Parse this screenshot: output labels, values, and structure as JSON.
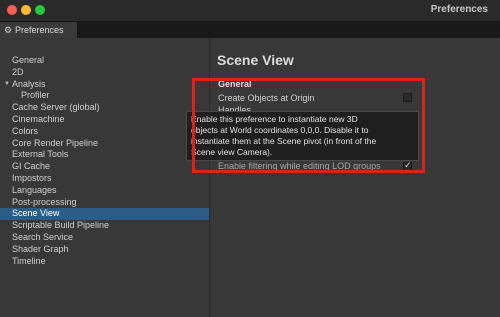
{
  "window": {
    "title": "Preferences",
    "tab_label": "Preferences"
  },
  "sidebar": {
    "items": [
      {
        "label": "General"
      },
      {
        "label": "2D"
      },
      {
        "label": "Analysis"
      },
      {
        "label": "Profiler"
      },
      {
        "label": "Cache Server (global)"
      },
      {
        "label": "Cinemachine"
      },
      {
        "label": "Colors"
      },
      {
        "label": "Core Render Pipeline"
      },
      {
        "label": "External Tools"
      },
      {
        "label": "GI Cache"
      },
      {
        "label": "Impostors"
      },
      {
        "label": "Languages"
      },
      {
        "label": "Post-processing"
      },
      {
        "label": "Scene View"
      },
      {
        "label": "Scriptable Build Pipeline"
      },
      {
        "label": "Search Service"
      },
      {
        "label": "Shader Graph"
      },
      {
        "label": "Timeline"
      }
    ],
    "selected": "Scene View"
  },
  "main": {
    "title": "Scene View",
    "section_general": "General",
    "create_objects_label": "Create Objects at Origin",
    "create_objects_checked": false,
    "handles_label": "Handles",
    "filtering_label": "Enable filtering while editing LOD groups",
    "filtering_checked": true
  },
  "tooltip": {
    "lines": [
      "Enable this preference to instantiate new 3D",
      "objects at World coordinates 0,0,0. Disable it to",
      "instantiate them at the Scene pivot (in front of the",
      "Scene view Camera)."
    ]
  },
  "colors": {
    "highlight": "#d8251b",
    "selection": "#2c5d87"
  }
}
